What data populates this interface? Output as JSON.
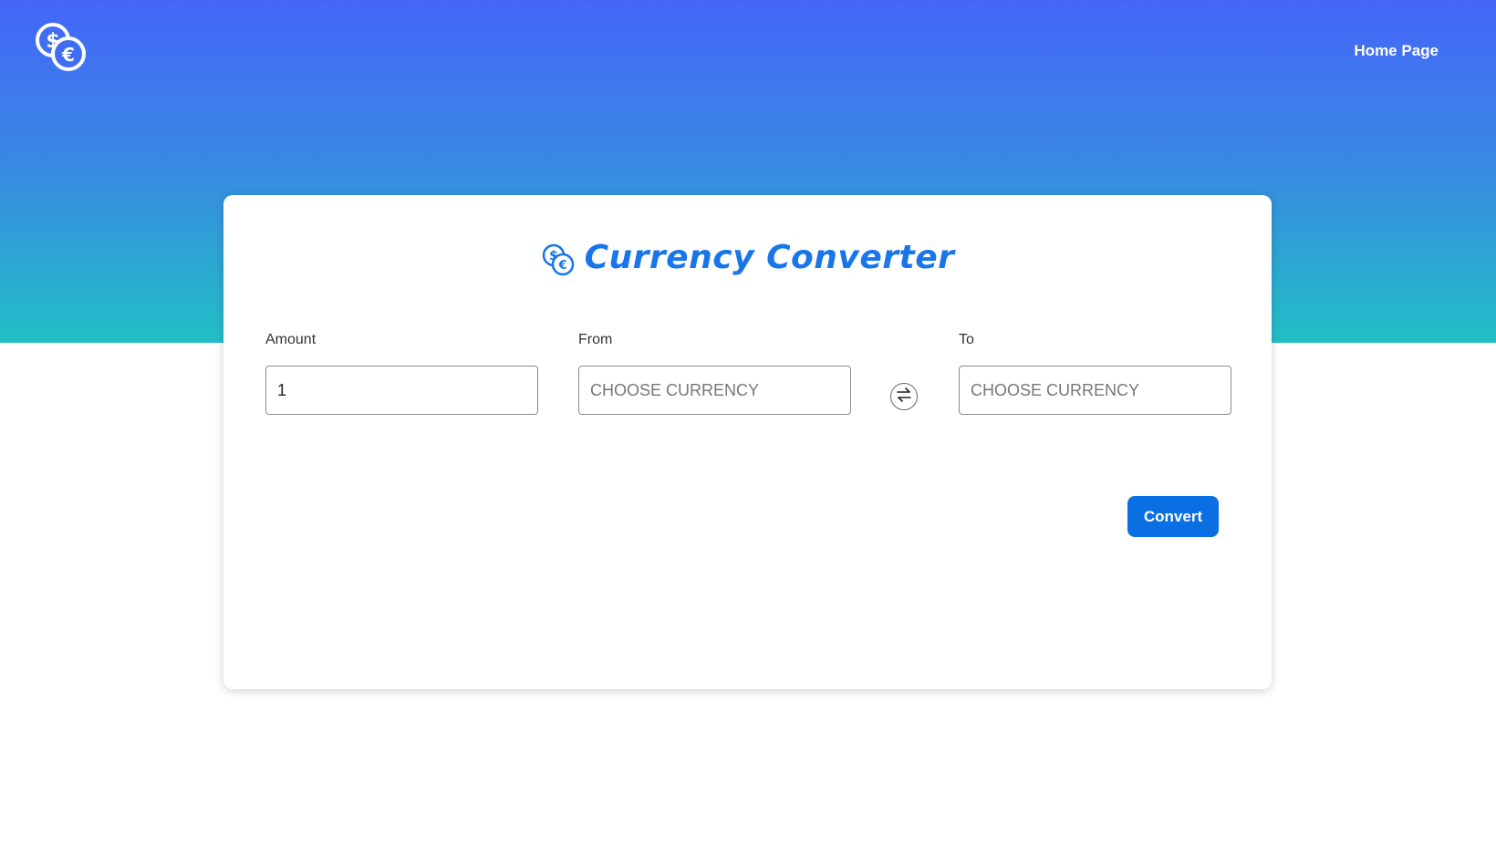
{
  "nav": {
    "logo_icon": "dollar-euro-coins-icon",
    "home_label": "Home Page"
  },
  "converter": {
    "title": "Currency Converter",
    "title_icon": "dollar-euro-coins-icon",
    "amount": {
      "label": "Amount",
      "value": "1"
    },
    "from": {
      "label": "From",
      "placeholder": "CHOOSE CURRENCY"
    },
    "swap_icon": "swap-arrows-icon",
    "to": {
      "label": "To",
      "placeholder": "CHOOSE CURRENCY"
    },
    "convert_label": "Convert"
  },
  "colors": {
    "hero_top": "#4466f8",
    "hero_bottom": "#22bfc6",
    "accent": "#0b6fe4",
    "title": "#1976e8"
  }
}
